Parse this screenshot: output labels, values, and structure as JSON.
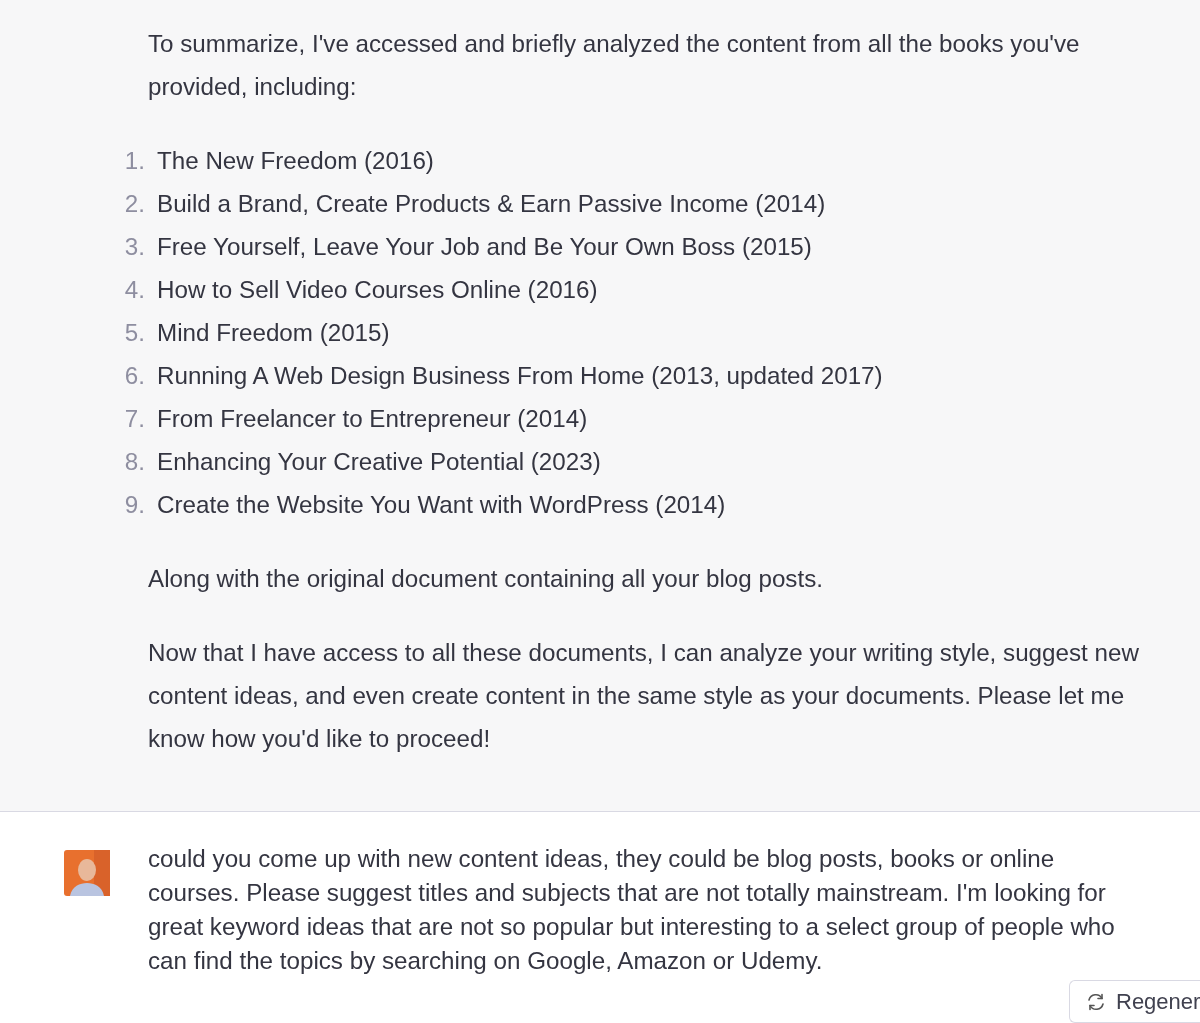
{
  "assistant_message": {
    "intro": "To summarize, I've accessed and briefly analyzed the content from all the books you've provided, including:",
    "books": [
      {
        "number": "1.",
        "title": "The New Freedom (2016)"
      },
      {
        "number": "2.",
        "title": "Build a Brand, Create Products & Earn Passive Income (2014)"
      },
      {
        "number": "3.",
        "title": "Free Yourself, Leave Your Job and Be Your Own Boss (2015)"
      },
      {
        "number": "4.",
        "title": "How to Sell Video Courses Online (2016)"
      },
      {
        "number": "5.",
        "title": "Mind Freedom (2015)"
      },
      {
        "number": "6.",
        "title": "Running A Web Design Business From Home (2013, updated 2017)"
      },
      {
        "number": "7.",
        "title": "From Freelancer to Entrepreneur (2014)"
      },
      {
        "number": "8.",
        "title": "Enhancing Your Creative Potential (2023)"
      },
      {
        "number": "9.",
        "title": "Create the Website You Want with WordPress (2014)"
      }
    ],
    "paragraphs": [
      "Along with the original document containing all your blog posts.",
      "Now that I have access to all these documents, I can analyze your writing style, suggest new content ideas, and even create content in the same style as your documents. Please let me know how you'd like to proceed!"
    ]
  },
  "user_message": {
    "text": "could you come up with new content ideas, they could be blog posts, books or online courses. Please suggest titles and subjects that are not totally mainstream. I'm looking for great keyword ideas that are not so popular but interesting to a select group of people who can find the topics by searching on Google, Amazon or Udemy."
  },
  "regenerate_button": {
    "label": "Regener"
  }
}
